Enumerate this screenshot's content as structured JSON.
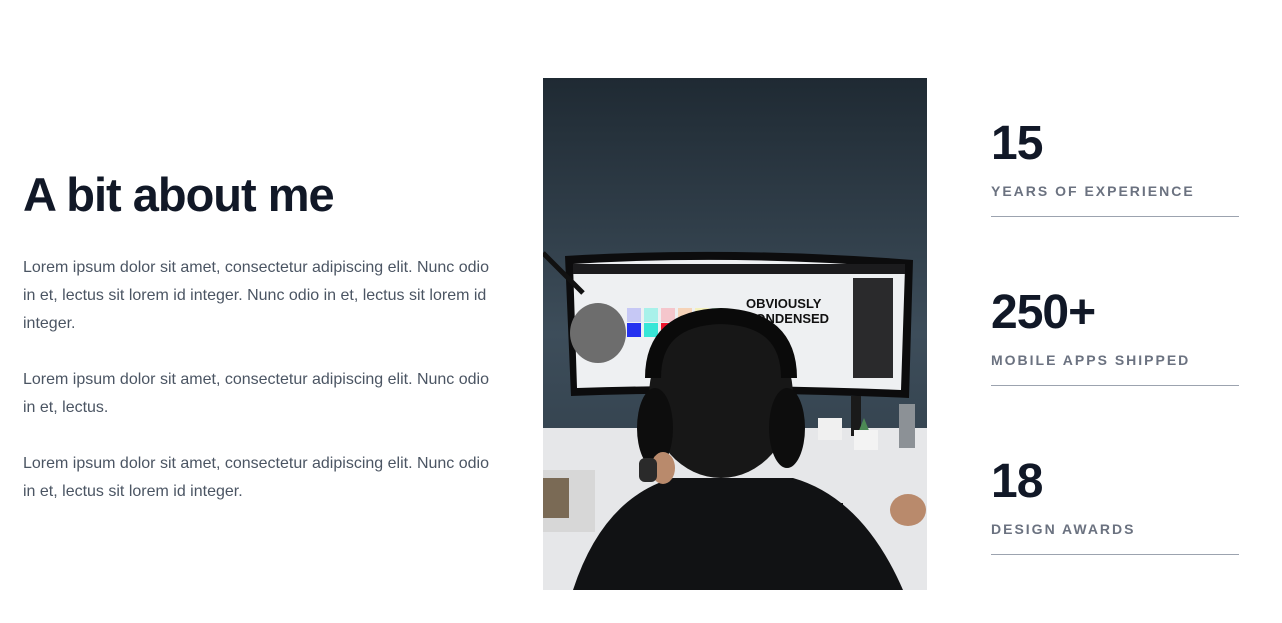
{
  "about": {
    "heading": "A bit about me",
    "paragraphs": [
      "Lorem ipsum dolor sit amet, consectetur adipiscing elit. Nunc odio in et, lectus sit lorem id integer. Nunc odio in et, lectus sit lorem id integer.",
      "Lorem ipsum dolor sit amet, consectetur adipiscing elit. Nunc odio in et, lectus.",
      "Lorem ipsum dolor sit amet, consectetur adipiscing elit. Nunc odio in et, lectus sit lorem id integer."
    ]
  },
  "photo": {
    "screen_text_line1": "OBVIOUSLY",
    "screen_text_line2": "CONDENSED"
  },
  "stats": [
    {
      "value": "15",
      "label": "YEARS OF EXPERIENCE"
    },
    {
      "value": "250+",
      "label": "MOBILE APPS SHIPPED"
    },
    {
      "value": "18",
      "label": "DESIGN AWARDS"
    }
  ],
  "colors": {
    "heading": "#111827",
    "body_text": "#4b5563",
    "label_text": "#6b7280",
    "divider": "#9ca3af",
    "wall": "#2b3a46",
    "desk": "#e5e7eb"
  }
}
